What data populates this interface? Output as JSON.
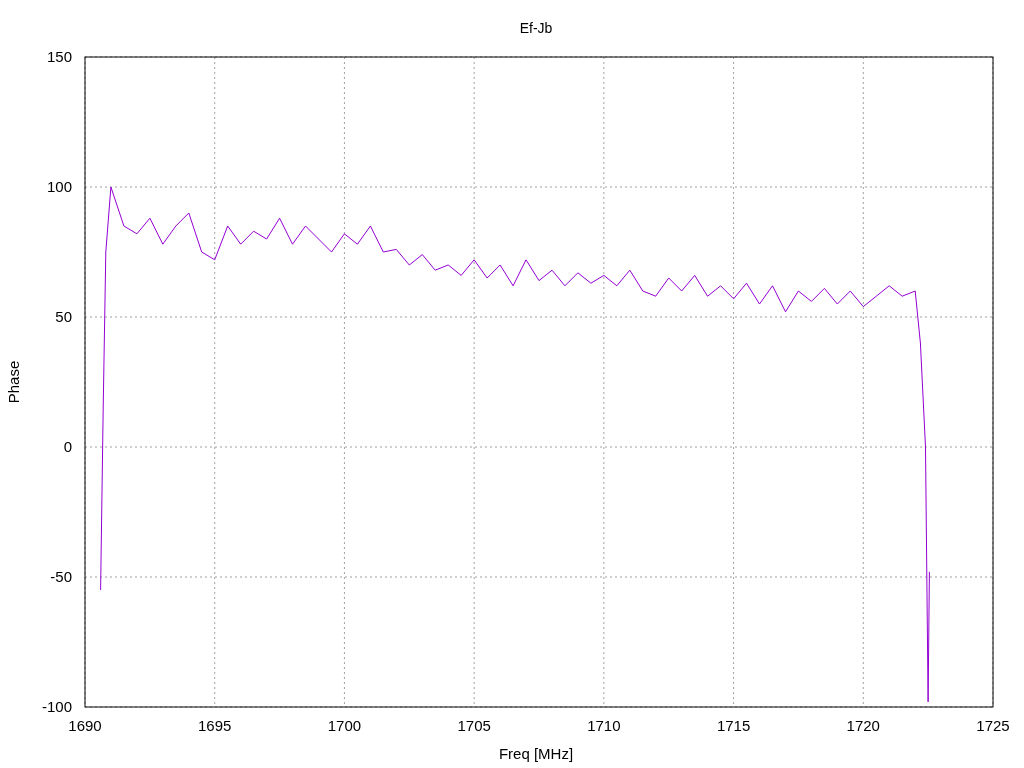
{
  "chart_data": {
    "type": "line",
    "title": "Ef-Jb",
    "xlabel": "Freq [MHz]",
    "ylabel": "Phase",
    "xlim": [
      1690,
      1725
    ],
    "ylim": [
      -100,
      150
    ],
    "xticks": [
      1690,
      1695,
      1700,
      1705,
      1710,
      1715,
      1720,
      1725
    ],
    "yticks": [
      -100,
      -50,
      0,
      50,
      100,
      150
    ],
    "grid": true,
    "x": [
      1690.6,
      1690.7,
      1690.8,
      1691.0,
      1691.5,
      1692,
      1692.5,
      1693,
      1693.5,
      1694,
      1694.5,
      1695,
      1695.5,
      1696,
      1696.5,
      1697,
      1697.5,
      1698,
      1698.5,
      1699,
      1699.5,
      1700,
      1700.5,
      1701,
      1701.5,
      1702,
      1702.5,
      1703,
      1703.5,
      1704,
      1704.5,
      1705,
      1705.5,
      1706,
      1706.5,
      1707,
      1707.5,
      1708,
      1708.5,
      1709,
      1709.5,
      1710,
      1710.5,
      1711,
      1711.5,
      1712,
      1712.5,
      1713,
      1713.5,
      1714,
      1714.5,
      1715,
      1715.5,
      1716,
      1716.5,
      1717,
      1717.5,
      1718,
      1718.5,
      1719,
      1719.5,
      1720,
      1720.5,
      1721,
      1721.5,
      1722,
      1722.2,
      1722.4,
      1722.5,
      1722.55
    ],
    "series": [
      {
        "color": "#9400d3",
        "values": [
          -55,
          15,
          75,
          100,
          85,
          82,
          88,
          78,
          85,
          90,
          75,
          72,
          85,
          78,
          83,
          80,
          88,
          78,
          85,
          80,
          75,
          82,
          78,
          85,
          75,
          76,
          70,
          74,
          68,
          70,
          66,
          72,
          65,
          70,
          62,
          72,
          64,
          68,
          62,
          67,
          63,
          66,
          62,
          68,
          60,
          58,
          65,
          60,
          66,
          58,
          62,
          57,
          63,
          55,
          62,
          52,
          60,
          56,
          61,
          55,
          60,
          54,
          58,
          62,
          58,
          60,
          40,
          0,
          -98,
          -48
        ]
      }
    ]
  }
}
